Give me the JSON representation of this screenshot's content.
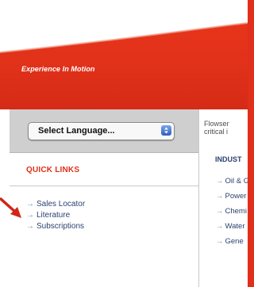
{
  "banner": {
    "tagline": "Experience In Motion"
  },
  "language": {
    "selected": "Select Language..."
  },
  "quick_links": {
    "title": "QUICK LINKS",
    "items": [
      "Sales Locator",
      "Literature",
      "Subscriptions"
    ]
  },
  "main": {
    "intro_lines": [
      "Flowser",
      "critical i"
    ],
    "industries_title": "INDUST",
    "industries": [
      "Oil & G",
      "Power",
      "Chemi",
      "Water",
      "Gene"
    ]
  },
  "colors": {
    "brand_red": "#e02f1a",
    "link_blue": "#2c4270",
    "sidebar_gray": "#cfcfcf"
  },
  "icons": {
    "pointer": "red-arrow-icon",
    "link_arrow": "arrow-right-icon",
    "select_arrows": "updown-arrows-icon"
  }
}
